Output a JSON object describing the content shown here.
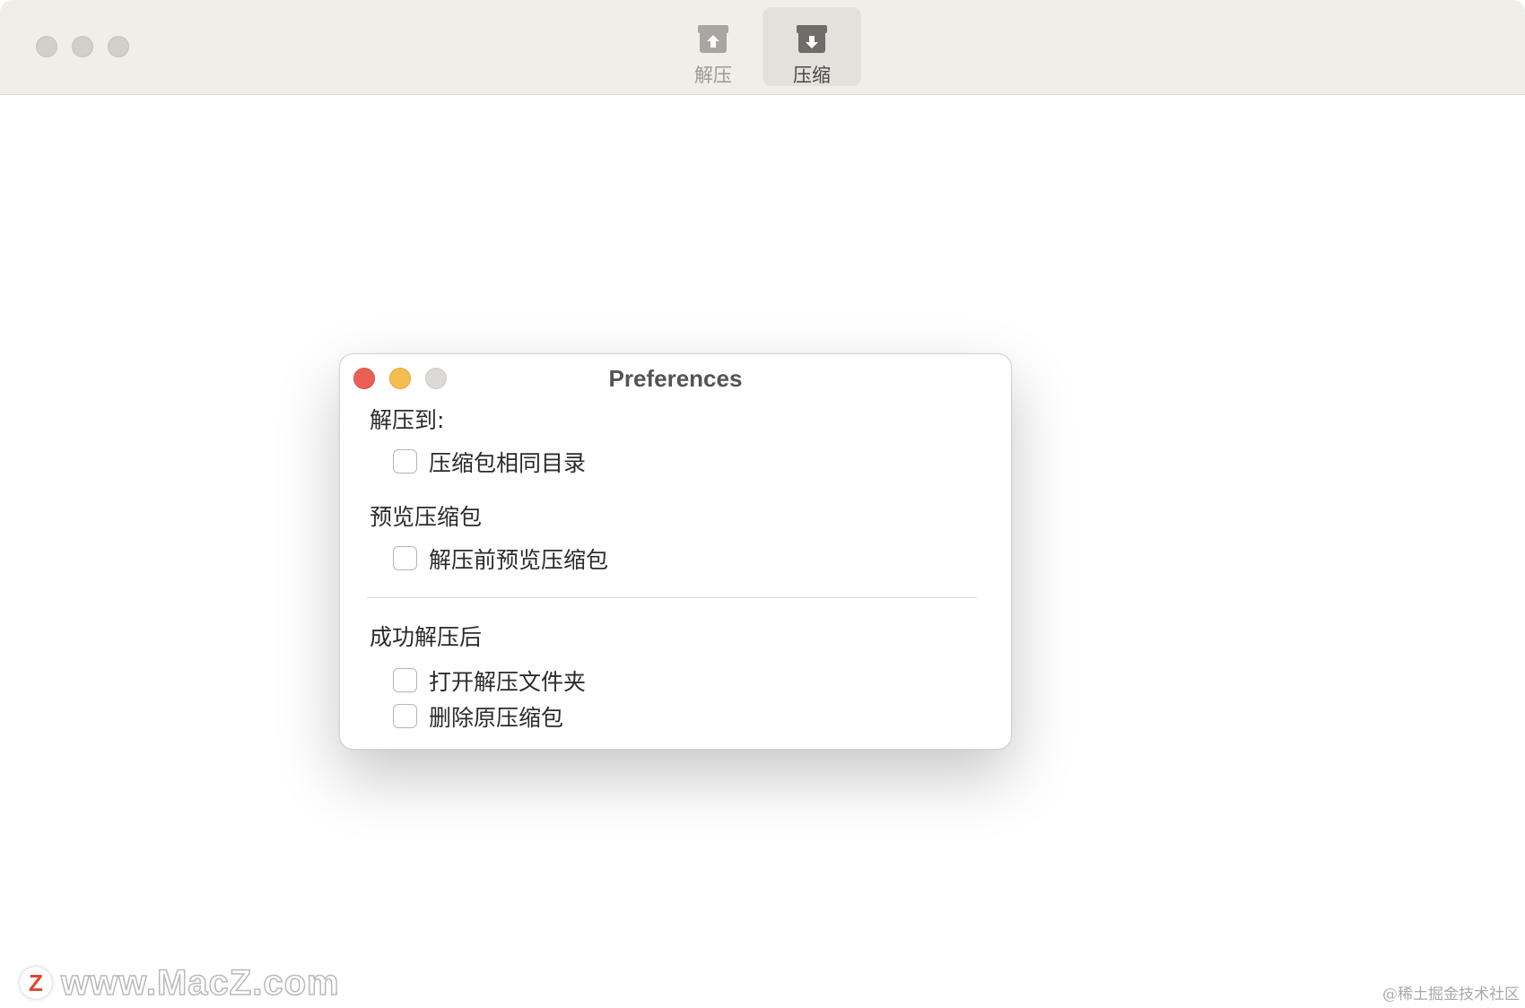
{
  "toolbar": {
    "items": [
      {
        "label": "解压",
        "icon": "box-upload-icon",
        "active": false
      },
      {
        "label": "压缩",
        "icon": "box-download-icon",
        "active": true
      }
    ]
  },
  "preferences": {
    "title": "Preferences",
    "sections": [
      {
        "label": "解压到:",
        "options": [
          {
            "label": "压缩包相同目录",
            "checked": false
          }
        ]
      },
      {
        "label": "预览压缩包",
        "options": [
          {
            "label": "解压前预览压缩包",
            "checked": false
          }
        ]
      },
      {
        "label": "成功解压后",
        "options": [
          {
            "label": "打开解压文件夹",
            "checked": false
          },
          {
            "label": "删除原压缩包",
            "checked": false
          }
        ]
      }
    ]
  },
  "watermark": {
    "logo_letter": "Z",
    "text": "www.MacZ.com",
    "credit": "@稀土掘金技术社区"
  },
  "colors": {
    "close": "#ec5f57",
    "minimize": "#f3be4f",
    "inactive": "#dcdad7",
    "titlebar": "#f1eee9"
  }
}
